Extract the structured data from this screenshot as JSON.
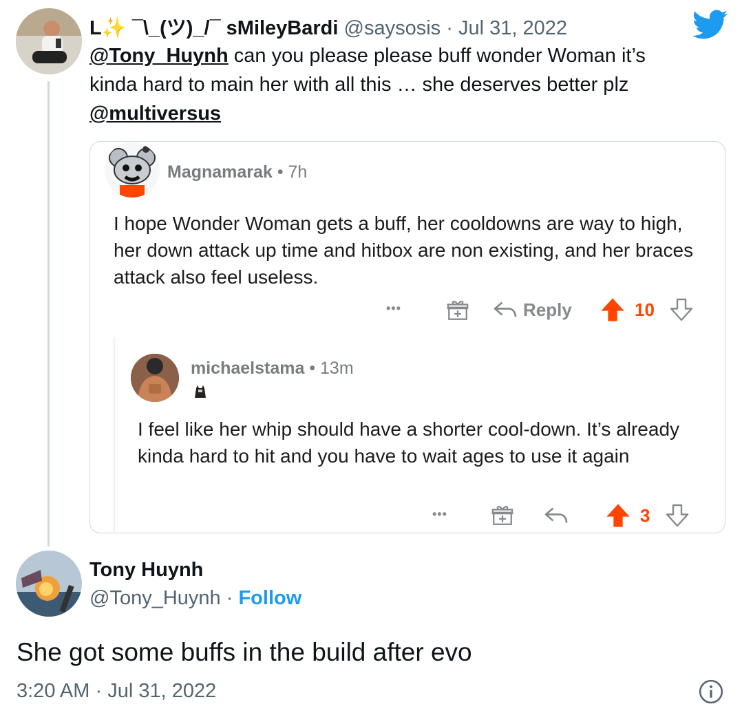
{
  "quoted_tweet": {
    "display_name": "L✨ ¯\\_(ツ)_/¯ sMileyBardi",
    "handle": "@saysosis",
    "separator": "·",
    "date": "Jul 31, 2022",
    "mention_1": "@Tony_Huynh",
    "text_1": " can you please please buff wonder Woman it’s kinda hard to main her with all this … she deserves better plz",
    "mention_2": "@multiversus"
  },
  "reddit_comment": {
    "username": "Magnamarak",
    "time": "• 7h",
    "text": "I hope Wonder Woman gets a buff, her cooldowns are way to high, her down attack up time and hitbox are non existing, and her braces attack also feel useless.",
    "more": "•••",
    "reply_label": "Reply",
    "score": "10"
  },
  "reddit_reply": {
    "username": "michaelstama",
    "time": "• 13m",
    "text": "I feel like her whip should have a shorter cool-down. It’s already kinda hard to hit and you have to wait ages to use it again",
    "more": "•••",
    "score": "3"
  },
  "main_tweet": {
    "display_name": "Tony Huynh",
    "handle": "@Tony_Huynh",
    "separator": "·",
    "follow_label": "Follow",
    "text": "She got some buffs in the build after evo",
    "time": "3:20 AM",
    "date": "Jul 31, 2022"
  },
  "colors": {
    "twitter_blue": "#1d9bf0",
    "reddit_orange": "#ff4500",
    "muted_gray": "#536471"
  },
  "icons": [
    "twitter-bird-icon",
    "gift-icon",
    "reply-arrow-icon",
    "upvote-icon",
    "downvote-icon",
    "info-icon"
  ]
}
